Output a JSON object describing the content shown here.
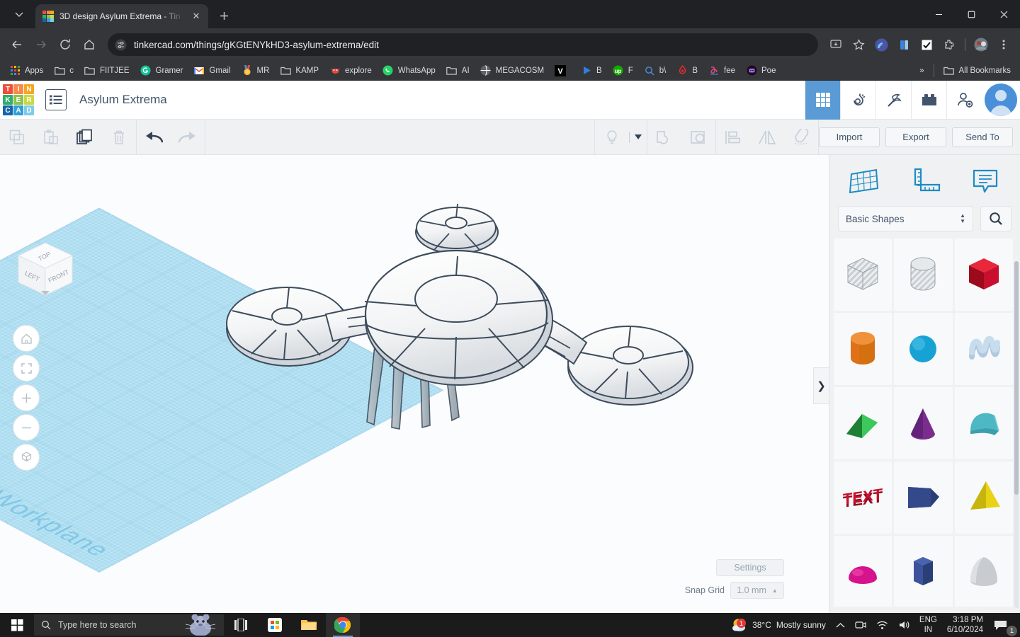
{
  "browser": {
    "tab": {
      "title": "3D design Asylum Extrema - Tin",
      "favicon_name": "tinkercad-favicon",
      "close_label": "✕"
    },
    "newtab_label": "+",
    "tab_list_label": "⌄",
    "window_controls": {
      "minimize": "—",
      "maximize": "▢",
      "close": "✕"
    },
    "nav": {
      "back_label": "←",
      "forward_label": "→",
      "reload_label": "⟳",
      "home_label": "⌂"
    },
    "omnibox": {
      "url": "tinkercad.com/things/gKGtENYkHD3-asylum-extrema/edit",
      "site_info_name": "site-settings-icon"
    },
    "toolbar_icons": [
      {
        "name": "install-app-icon"
      },
      {
        "name": "bookmark-star-icon"
      },
      {
        "name": "extension-sonar-icon"
      },
      {
        "name": "extension-books-icon"
      },
      {
        "name": "extension-checkmark-icon"
      },
      {
        "name": "extensions-puzzle-icon"
      },
      {
        "name": "profile-avatar-icon"
      },
      {
        "name": "chrome-menu-icon"
      }
    ],
    "bookmarks": [
      {
        "label": "Apps",
        "icon": "apps-grid-icon"
      },
      {
        "label": "c",
        "icon": "folder-icon"
      },
      {
        "label": "FIITJEE",
        "icon": "folder-icon"
      },
      {
        "label": "Gramer",
        "icon": "grammarly-icon"
      },
      {
        "label": "Gmail",
        "icon": "gmail-icon"
      },
      {
        "label": "MR",
        "icon": "medal-icon"
      },
      {
        "label": "KAMP",
        "icon": "folder-icon"
      },
      {
        "label": "explore",
        "icon": "crab-icon"
      },
      {
        "label": "WhatsApp",
        "icon": "whatsapp-icon"
      },
      {
        "label": "AI",
        "icon": "folder-icon"
      },
      {
        "label": "MEGACOSM",
        "icon": "globe-icon"
      },
      {
        "label": "",
        "icon": "v-square-icon"
      },
      {
        "label": "B",
        "icon": "blue-play-icon"
      },
      {
        "label": "F",
        "icon": "upwork-icon"
      },
      {
        "label": "b\\",
        "icon": "search-icon"
      },
      {
        "label": "B",
        "icon": "brand-red-icon"
      },
      {
        "label": "fee",
        "icon": "monkeytype-icon"
      },
      {
        "label": "Poe",
        "icon": "poe-icon"
      }
    ],
    "bookmarks_overflow_label": "»",
    "all_bookmarks_label": "All Bookmarks"
  },
  "tinkercad": {
    "logo_tiles": [
      {
        "letter": "T",
        "color": "#ef4e3a"
      },
      {
        "letter": "I",
        "color": "#f58a4b"
      },
      {
        "letter": "N",
        "color": "#f5a623"
      },
      {
        "letter": "K",
        "color": "#2fae6b"
      },
      {
        "letter": "E",
        "color": "#8bc34a"
      },
      {
        "letter": "R",
        "color": "#c9d844"
      },
      {
        "letter": "C",
        "color": "#1565a8"
      },
      {
        "letter": "A",
        "color": "#2f9fd8"
      },
      {
        "letter": "D",
        "color": "#7fcbe8"
      }
    ],
    "panel_toggle_name": "project-panel-button",
    "design_title": "Asylum Extrema",
    "header_icons": [
      {
        "name": "blocks-grid-icon",
        "active": true
      },
      {
        "name": "circuits-icon",
        "active": false
      },
      {
        "name": "minecraft-pickaxe-icon",
        "active": false
      },
      {
        "name": "lego-brick-icon",
        "active": false
      },
      {
        "name": "invite-people-icon",
        "active": false
      }
    ],
    "avatar_name": "user-avatar",
    "toolbar": {
      "left_buttons": [
        {
          "name": "copy-button",
          "icon": "copy-icon",
          "enabled": false
        },
        {
          "name": "paste-button",
          "icon": "paste-icon",
          "enabled": false
        },
        {
          "name": "duplicate-button",
          "icon": "duplicate-icon",
          "enabled": true
        },
        {
          "name": "delete-button",
          "icon": "trash-icon",
          "enabled": false
        }
      ],
      "history_buttons": [
        {
          "name": "undo-button",
          "icon": "undo-arrow-icon",
          "enabled": true
        },
        {
          "name": "redo-button",
          "icon": "redo-arrow-icon",
          "enabled": false
        }
      ],
      "mid_buttons": [
        {
          "name": "lightbulb-button",
          "icon": "lightbulb-icon",
          "enabled": false
        },
        {
          "name": "group-button",
          "icon": "group-shapes-icon",
          "enabled": false
        },
        {
          "name": "ungroup-button",
          "icon": "ungroup-shapes-icon",
          "enabled": false
        },
        {
          "name": "align-button",
          "icon": "align-icon",
          "enabled": false
        },
        {
          "name": "mirror-button",
          "icon": "mirror-flip-icon",
          "enabled": false
        },
        {
          "name": "magnet-button",
          "icon": "magnet-icon",
          "enabled": false
        }
      ],
      "import_label": "Import",
      "export_label": "Export",
      "send_to_label": "Send To"
    },
    "viewport": {
      "viewcube": {
        "top_label": "TOP",
        "left_label": "LEFT",
        "front_label": "FRONT"
      },
      "controls": [
        {
          "name": "home-view-button",
          "icon": "home-icon"
        },
        {
          "name": "fit-to-view-button",
          "icon": "fit-view-icon"
        },
        {
          "name": "zoom-in-button",
          "icon": "plus-icon"
        },
        {
          "name": "zoom-out-button",
          "icon": "minus-icon"
        },
        {
          "name": "perspective-toggle-button",
          "icon": "cube-ortho-icon"
        }
      ],
      "workplane_watermark": "Workplane",
      "settings_label": "Settings",
      "snap_grid_label": "Snap Grid",
      "snap_grid_value": "1.0 mm",
      "snap_grid_caret": "▲",
      "panel_collapse_label": "❯"
    },
    "shapes_panel": {
      "tool_icons": [
        {
          "name": "workplane-icon"
        },
        {
          "name": "ruler-icon"
        },
        {
          "name": "notes-icon"
        }
      ],
      "category_value": "Basic Shapes",
      "search_icon_name": "search-icon",
      "shapes": [
        {
          "name": "box-hole",
          "color": "#c9ced3",
          "kind": "cube",
          "hole": true
        },
        {
          "name": "cylinder-hole",
          "color": "#c9ced3",
          "kind": "cylinder",
          "hole": true
        },
        {
          "name": "box",
          "color": "#c8102e",
          "kind": "cube",
          "hole": false
        },
        {
          "name": "cylinder",
          "color": "#e0711a",
          "kind": "cylinder",
          "hole": false
        },
        {
          "name": "sphere",
          "color": "#17a2d4",
          "kind": "sphere",
          "hole": false
        },
        {
          "name": "scribble",
          "color": "#aec9e0",
          "kind": "scribble",
          "hole": false
        },
        {
          "name": "wedge",
          "color": "#2faf4a",
          "kind": "wedge",
          "hole": false
        },
        {
          "name": "cone",
          "color": "#7b2d8e",
          "kind": "cone",
          "hole": false
        },
        {
          "name": "roof",
          "color": "#4db8c4",
          "kind": "roof",
          "hole": false
        },
        {
          "name": "text",
          "color": "#c8102e",
          "kind": "text",
          "hole": false,
          "label": "TEXT"
        },
        {
          "name": "polygon-box",
          "color": "#2b3f77",
          "kind": "polybox",
          "hole": false
        },
        {
          "name": "pyramid",
          "color": "#e8d317",
          "kind": "pyramid",
          "hole": false
        },
        {
          "name": "half-sphere",
          "color": "#d6128c",
          "kind": "dome",
          "hole": false
        },
        {
          "name": "hexagonal-prism",
          "color": "#2b3f77",
          "kind": "hexprism",
          "hole": false
        },
        {
          "name": "paraboloid",
          "color": "#c8ccd0",
          "kind": "paraboloid",
          "hole": false
        }
      ]
    }
  },
  "taskbar": {
    "start_name": "windows-start-button",
    "search_placeholder": "Type here to search",
    "apps": [
      {
        "name": "task-view-button",
        "icon": "task-view-icon",
        "active": false
      },
      {
        "name": "microsoft-store-button",
        "icon": "store-icon",
        "active": false
      },
      {
        "name": "file-explorer-button",
        "icon": "folder-icon",
        "active": false
      },
      {
        "name": "chrome-button",
        "icon": "chrome-icon",
        "active": true
      }
    ],
    "weather": {
      "temperature": "38°C",
      "condition": "Mostly sunny",
      "badge": "1"
    },
    "tray_icons": [
      {
        "name": "show-hidden-icons-chevron"
      },
      {
        "name": "camera-icon"
      },
      {
        "name": "wifi-icon"
      },
      {
        "name": "volume-icon"
      }
    ],
    "language": {
      "line1": "ENG",
      "line2": "IN"
    },
    "clock": {
      "time": "3:18 PM",
      "date": "6/10/2024"
    },
    "notifications": {
      "name": "action-center-icon",
      "badge": "1"
    }
  }
}
